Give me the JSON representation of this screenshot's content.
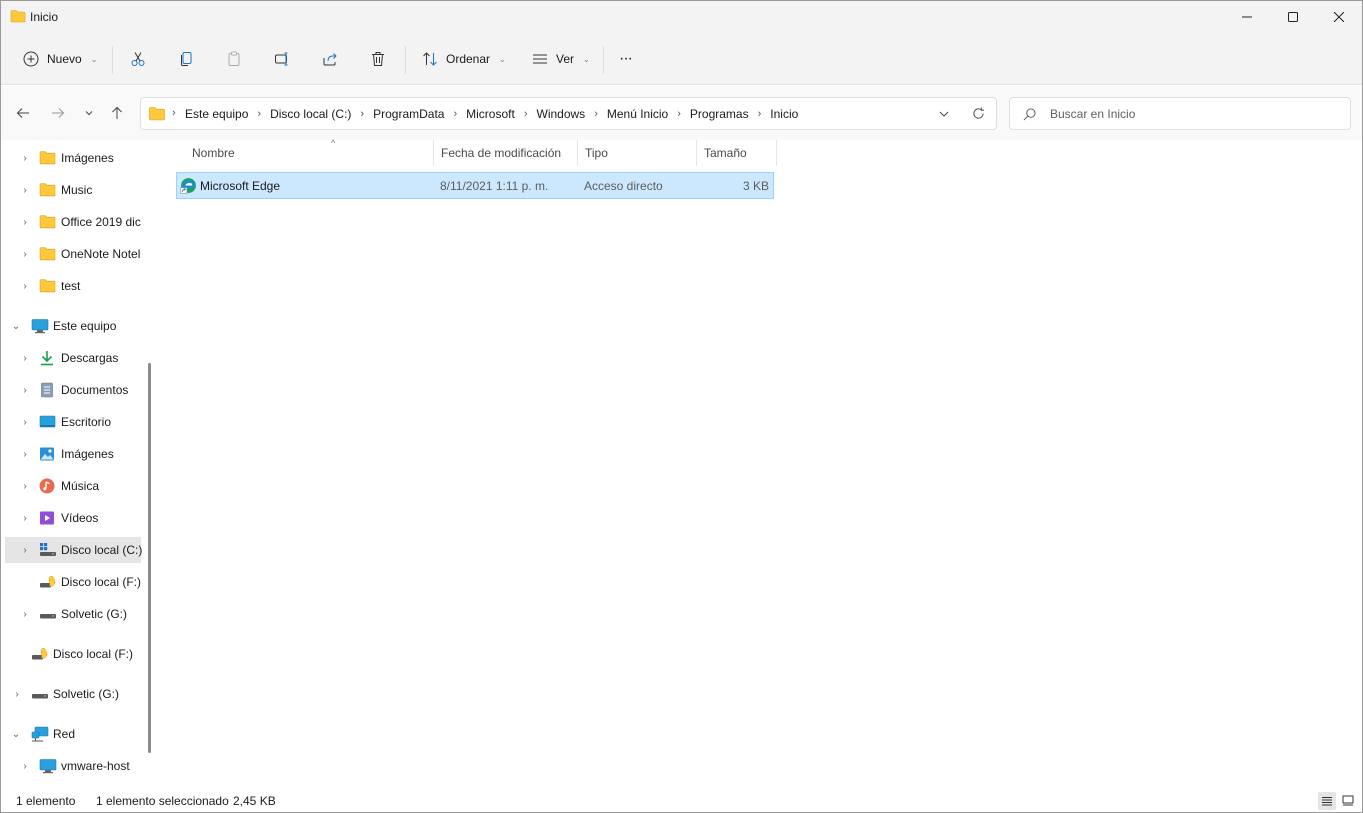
{
  "window": {
    "title": "Inicio"
  },
  "commands": {
    "new_label": "Nuevo",
    "sort_label": "Ordenar",
    "view_label": "Ver",
    "more_label": "···"
  },
  "address": {
    "crumbs": [
      "Este equipo",
      "Disco local (C:)",
      "ProgramData",
      "Microsoft",
      "Windows",
      "Menú Inicio",
      "Programas",
      "Inicio"
    ],
    "separator": "›"
  },
  "search": {
    "placeholder": "Buscar en Inicio"
  },
  "sidebar": {
    "items": [
      {
        "label": "Imágenes",
        "icon": "folder-icon"
      },
      {
        "label": "Music",
        "icon": "folder-icon"
      },
      {
        "label": "Office 2019 dic",
        "icon": "folder-icon"
      },
      {
        "label": "OneNote Notel",
        "icon": "folder-icon"
      },
      {
        "label": "test",
        "icon": "folder-icon"
      },
      {
        "label": "Este equipo",
        "icon": "computer-icon"
      },
      {
        "label": "Descargas",
        "icon": "download-icon"
      },
      {
        "label": "Documentos",
        "icon": "documents-icon"
      },
      {
        "label": "Escritorio",
        "icon": "desktop-icon"
      },
      {
        "label": "Imágenes",
        "icon": "pictures-icon"
      },
      {
        "label": "Música",
        "icon": "music-icon"
      },
      {
        "label": "Vídeos",
        "icon": "videos-icon"
      },
      {
        "label": "Disco local (C:)",
        "icon": "windows-drive-icon"
      },
      {
        "label": "Disco local (F:)",
        "icon": "usb-drive-icon"
      },
      {
        "label": "Solvetic (G:)",
        "icon": "drive-icon"
      },
      {
        "label": "Disco local (F:)",
        "icon": "usb-drive-icon"
      },
      {
        "label": "Solvetic (G:)",
        "icon": "drive-icon"
      },
      {
        "label": "Red",
        "icon": "network-icon"
      },
      {
        "label": "vmware-host",
        "icon": "network-computer-icon"
      }
    ]
  },
  "columns": {
    "name": "Nombre",
    "modified": "Fecha de modificación",
    "type": "Tipo",
    "size": "Tamaño"
  },
  "files": [
    {
      "name": "Microsoft Edge",
      "modified": "8/11/2021 1:11 p. m.",
      "type": "Acceso directo",
      "size": "3 KB",
      "icon": "edge-icon"
    }
  ],
  "status": {
    "count": "1 elemento",
    "selection": "1 elemento seleccionado",
    "selection_size": "2,45 KB"
  },
  "colors": {
    "selection_bg": "#cce8ff",
    "selection_border": "#99d1ff",
    "folder": "#ffc83d",
    "chrome": "#f3f3f3"
  }
}
